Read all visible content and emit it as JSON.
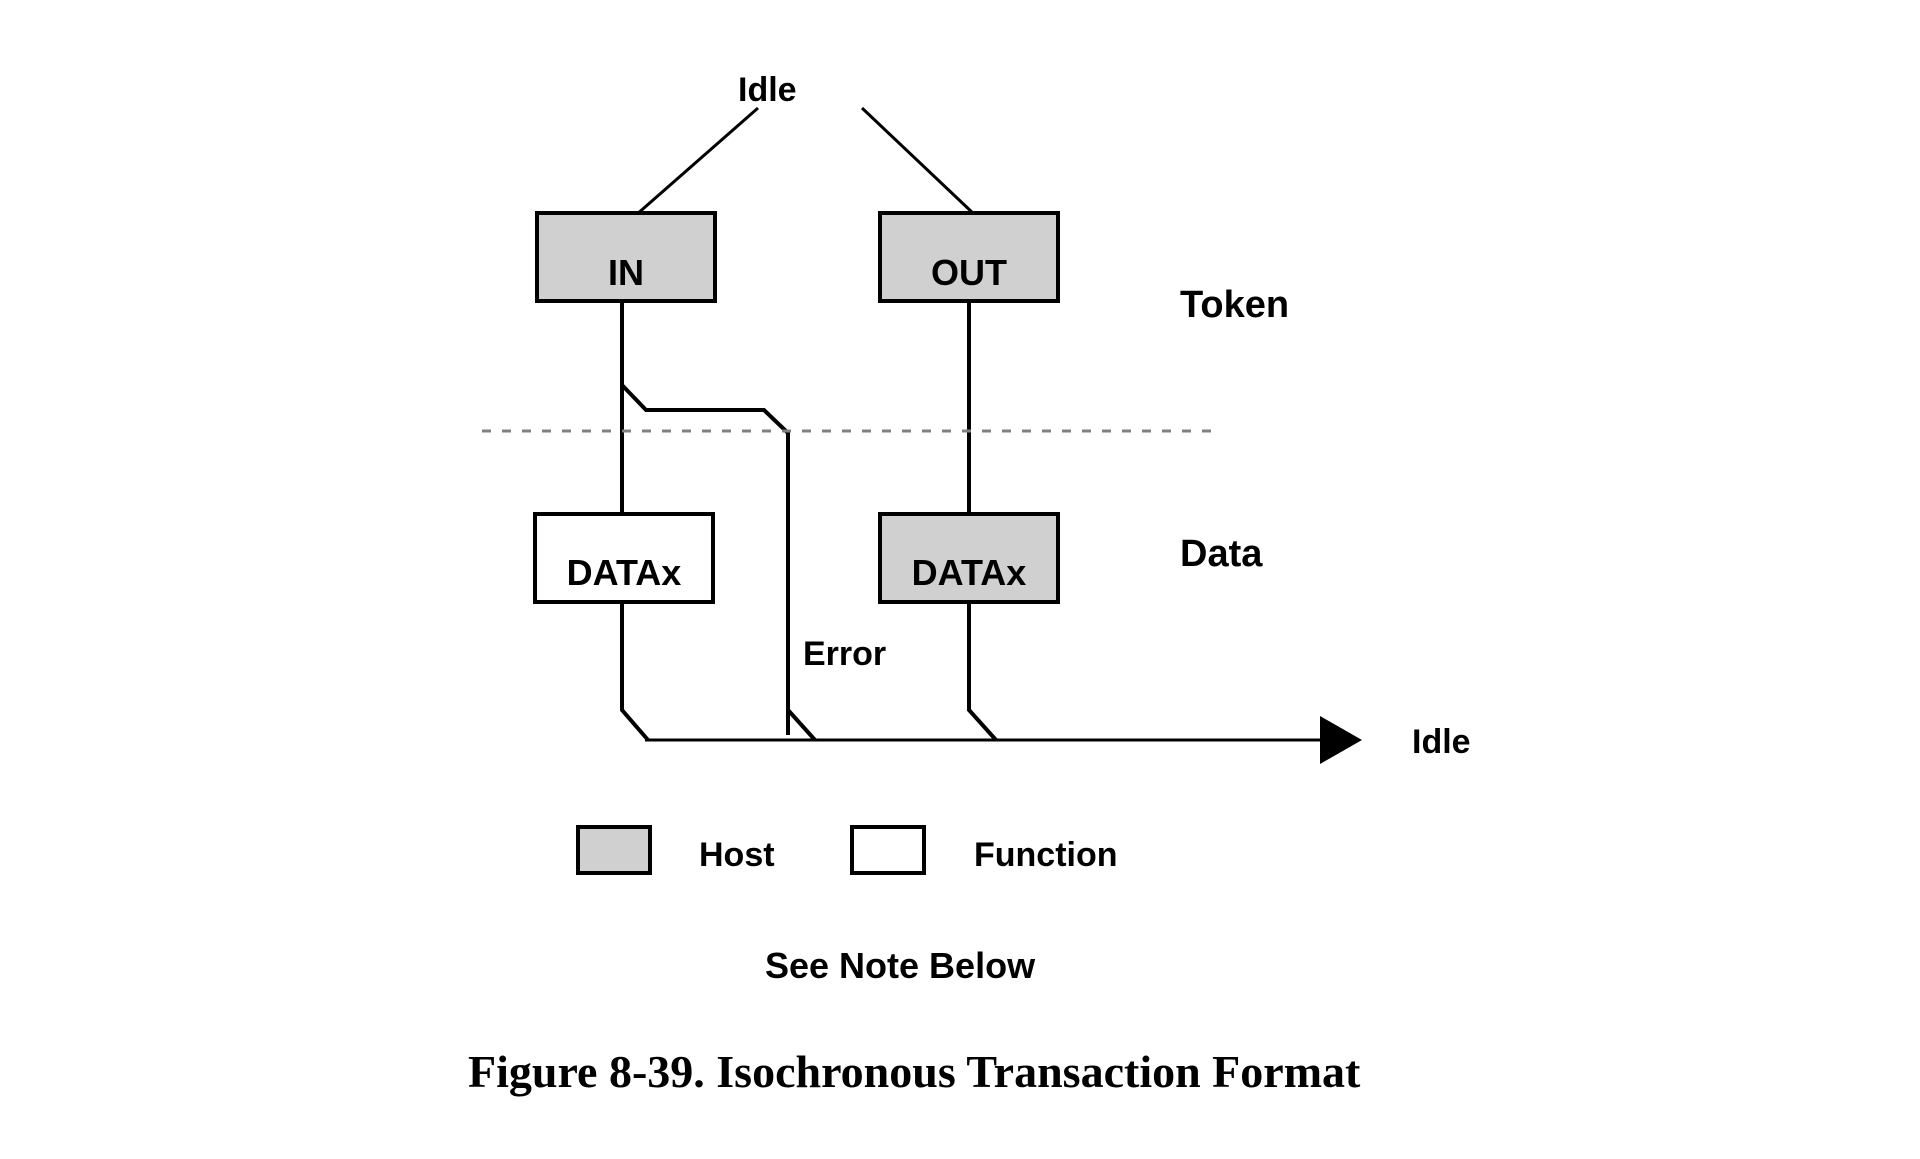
{
  "figure": {
    "caption": "Figure 8-39.  Isochronous Transaction Format",
    "note": "See Note Below"
  },
  "states": {
    "idle_top": "Idle",
    "idle_end": "Idle",
    "error": "Error"
  },
  "stages": [
    {
      "name": "token",
      "label": "Token"
    },
    {
      "name": "data",
      "label": "Data"
    }
  ],
  "nodes": [
    {
      "id": "in-token",
      "label": "IN",
      "owner": "host",
      "fill": "#d0d0d0"
    },
    {
      "id": "out-token",
      "label": "OUT",
      "owner": "host",
      "fill": "#d0d0d0"
    },
    {
      "id": "data-in",
      "label": "DATAx",
      "owner": "function",
      "fill": "#ffffff"
    },
    {
      "id": "data-out",
      "label": "DATAx",
      "owner": "host",
      "fill": "#d0d0d0"
    }
  ],
  "legend": {
    "items": [
      {
        "name": "host",
        "label": "Host",
        "fill": "#d0d0d0"
      },
      {
        "name": "function",
        "label": "Function",
        "fill": "#ffffff"
      }
    ]
  },
  "colors": {
    "host_fill": "#d0d0d0",
    "function_fill": "#ffffff",
    "stroke": "#000000",
    "divider": "#808080",
    "background": "#ffffff"
  }
}
